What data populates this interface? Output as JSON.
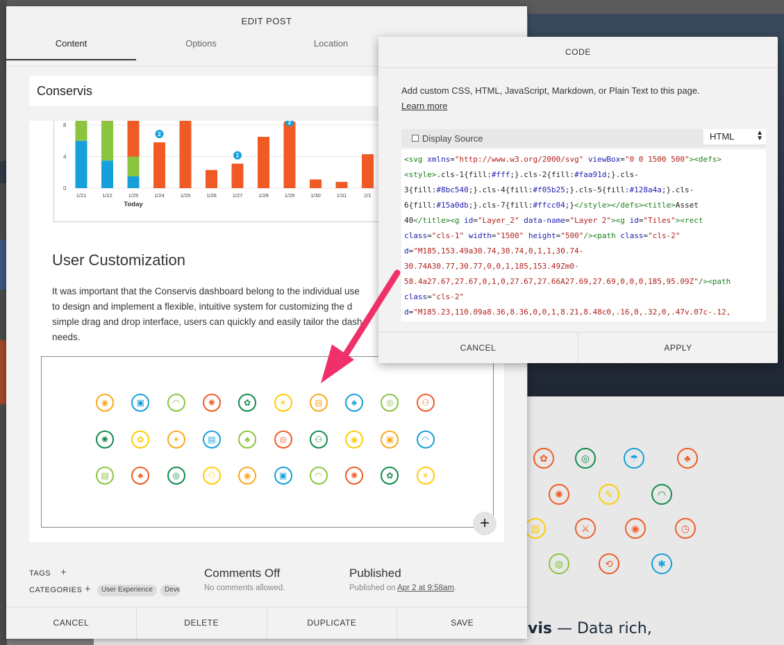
{
  "colors": {
    "green": "#8bc540",
    "orange": "#faa91d",
    "red": "#f05b25",
    "teal": "#128a4a",
    "blue": "#15a0db",
    "yellow": "#ffcc04",
    "arrow": "#f0306a"
  },
  "edit_post": {
    "title": "EDIT POST",
    "tabs": [
      "Content",
      "Options",
      "Location"
    ],
    "post_title": "Conservis",
    "section_heading": "User Customization",
    "body_lines": [
      "It was important that the Conservis dashboard belong to the individual use",
      "to design and implement a flexible, intuitive system for customizing the d",
      "simple drag and drop interface, users can quickly and easily tailor the dash",
      "needs."
    ],
    "tags_label": "TAGS",
    "categories_label": "CATEGORIES",
    "categories": [
      "User Experience",
      "Deve"
    ],
    "comments_title": "Comments Off",
    "comments_sub": "No comments allowed.",
    "published_title": "Published",
    "published_prefix": "Published on ",
    "published_date": "Apr 2 at 9:58am",
    "published_suffix": ".",
    "footer": [
      "CANCEL",
      "DELETE",
      "DUPLICATE",
      "SAVE"
    ]
  },
  "chart_data": {
    "type": "bar",
    "categories": [
      "1/21",
      "1/22",
      "1/25",
      "1/24",
      "1/25",
      "1/26",
      "1/27",
      "1/28",
      "1/29",
      "1/30",
      "1/31",
      "2/1"
    ],
    "ylim": [
      0,
      8
    ],
    "yticks": [
      0,
      4,
      8
    ],
    "series": [
      {
        "values": [
          6,
          3.5,
          1.5,
          0,
          0,
          0,
          0,
          0,
          0,
          0,
          0,
          0
        ],
        "color": "#15a0db"
      },
      {
        "values": [
          3,
          5,
          2.5,
          0,
          0,
          0,
          0,
          0,
          0,
          0,
          0,
          0
        ],
        "color": "#8bc540"
      },
      {
        "values": [
          0,
          1,
          5,
          5.8,
          9.5,
          2.3,
          3.1,
          6.5,
          8.4,
          1.1,
          0.8,
          4.3
        ],
        "color": "#f05b25"
      }
    ],
    "badges": [
      {
        "category_index": 3,
        "label": "2"
      },
      {
        "category_index": 6,
        "label": "1"
      },
      {
        "category_index": 8,
        "label": "2"
      }
    ],
    "today_label": "Today"
  },
  "icon_grid": [
    [
      "#faa91d",
      "#15a0db",
      "#8bc540",
      "#f05b25",
      "#128a4a",
      "#ffcc04",
      "#faa91d",
      "#15a0db",
      "#8bc540",
      "#f05b25"
    ],
    [
      "#128a4a",
      "#ffcc04",
      "#faa91d",
      "#15a0db",
      "#8bc540",
      "#f05b25",
      "#128a4a",
      "#ffcc04",
      "#faa91d",
      "#15a0db"
    ],
    [
      "#8bc540",
      "#f05b25",
      "#128a4a",
      "#ffcc04",
      "#faa91d",
      "#15a0db",
      "#8bc540",
      "#f05b25",
      "#128a4a",
      "#ffcc04"
    ]
  ],
  "code_dialog": {
    "title": "CODE",
    "description": "Add custom CSS, HTML, JavaScript, Markdown, or Plain Text to this page.",
    "learn_more": "Learn more",
    "display_source": "Display Source",
    "language": "HTML",
    "cancel": "CANCEL",
    "apply": "APPLY"
  },
  "background": {
    "footer_bold": "vis",
    "footer_dash": " — ",
    "footer_rest": "Data rich,"
  }
}
